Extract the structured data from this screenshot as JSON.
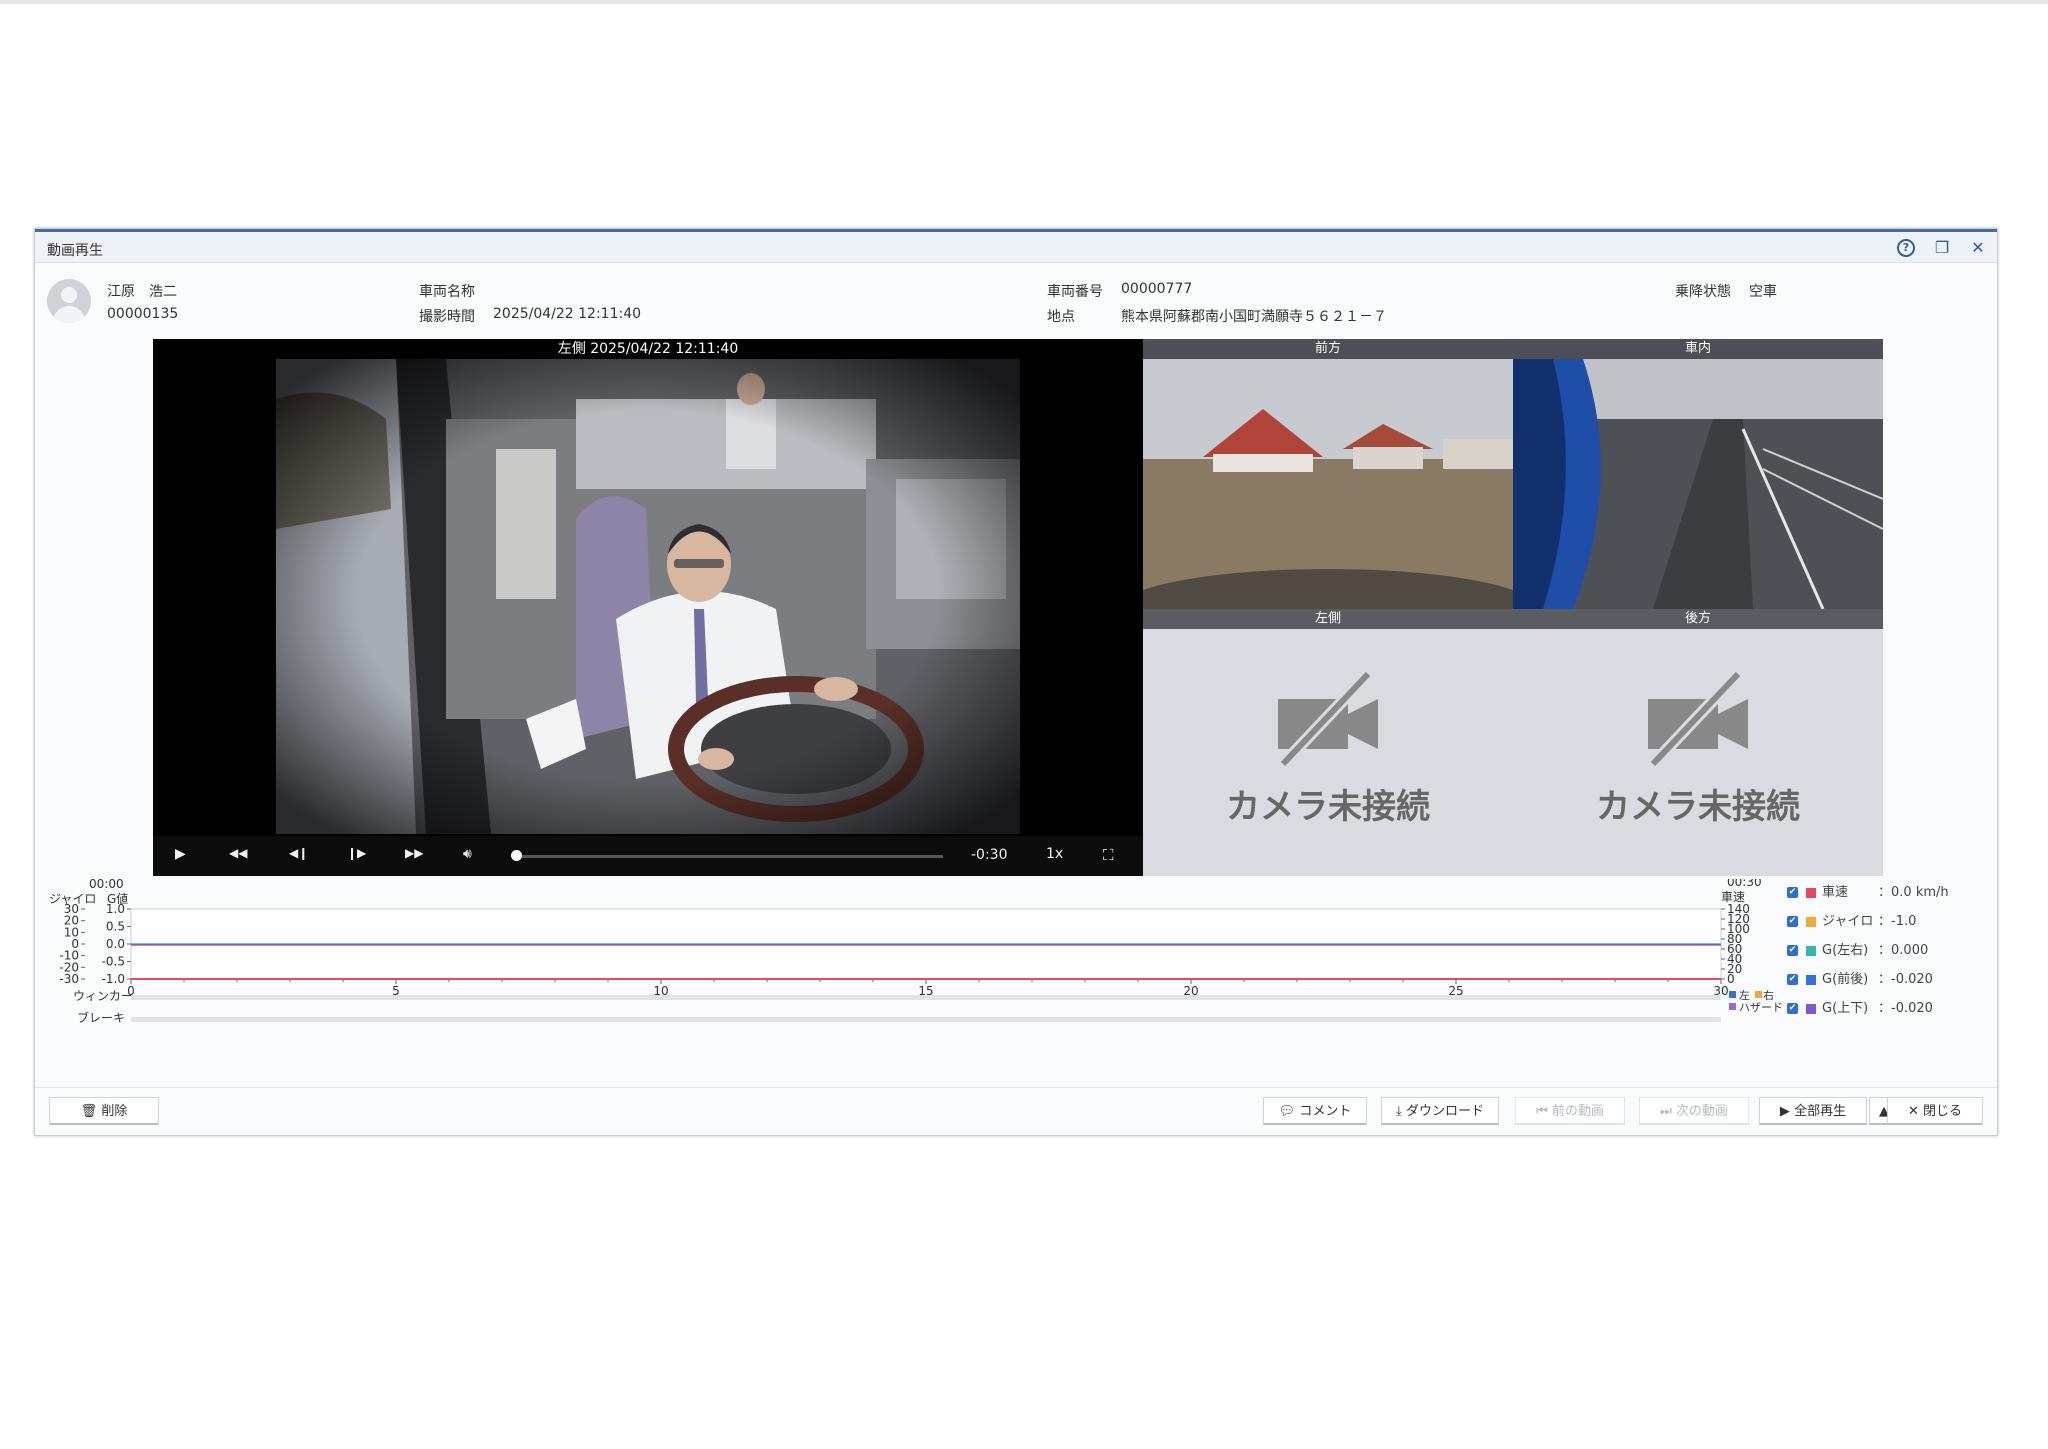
{
  "window": {
    "title": "動画再生",
    "help_icon": "?",
    "restore_icon": "❐",
    "close_icon": "✕"
  },
  "driver": {
    "name": "江原　浩二",
    "id": "00000135"
  },
  "vehicle": {
    "name_label": "車両名称",
    "name_value": "",
    "shot_time_label": "撮影時間",
    "shot_time_value": "2025/04/22 12:11:40",
    "number_label": "車両番号",
    "number_value": "00000777",
    "location_label": "地点",
    "location_value": "熊本県阿蘇郡南小国町満願寺５６２１－７",
    "ride_status_label": "乗降状態",
    "ride_status_value": "空車"
  },
  "main_video": {
    "caption": "左側 2025/04/22 12:11:40",
    "time_remaining": "-0:30",
    "speed": "1x",
    "progress": 0.0
  },
  "cameras": [
    {
      "label": "前方",
      "connected": true
    },
    {
      "label": "車内",
      "connected": true
    },
    {
      "label": "左側",
      "connected": false,
      "message": "カメラ未接続"
    },
    {
      "label": "後方",
      "connected": false,
      "message": "カメラ未接続"
    }
  ],
  "chart_data": {
    "type": "line",
    "start_label": "00:00",
    "end_label": "00:30",
    "x_ticks": [
      0,
      5,
      10,
      15,
      20,
      25,
      30
    ],
    "xlim": [
      0,
      30
    ],
    "left_axis_gyro": {
      "label": "ジャイロ",
      "ticks": [
        30,
        20,
        10,
        0,
        -10,
        -20,
        -30
      ],
      "ylim": [
        -30,
        30
      ]
    },
    "left_axis_g": {
      "label": "G値",
      "ticks": [
        "1.0",
        "0.5",
        "0.0",
        "-0.5",
        "-1.0"
      ],
      "ylim": [
        -1.0,
        1.0
      ]
    },
    "right_axis_speed": {
      "label": "車速",
      "ticks": [
        140,
        120,
        100,
        80,
        60,
        40,
        20,
        0
      ],
      "ylim": [
        0,
        140
      ]
    },
    "series": [
      {
        "name": "車速",
        "color": "#e8495e",
        "value_text": "0.0 km/h",
        "values": [
          0,
          0,
          0,
          0,
          0,
          0,
          0
        ]
      },
      {
        "name": "ジャイロ",
        "color": "#f2a93b",
        "value_text": "-1.0",
        "values": [
          -1,
          -1,
          -1,
          -1,
          -1,
          -1,
          -1
        ]
      },
      {
        "name": "G(左右)",
        "color": "#3bb3a5",
        "value_text": "0.000",
        "values": [
          0,
          0,
          0,
          0,
          0,
          0,
          0
        ]
      },
      {
        "name": "G(前後)",
        "color": "#3b6fd8",
        "value_text": "-0.020",
        "values": [
          -0.02,
          -0.02,
          -0.02,
          -0.02,
          -0.02,
          -0.02,
          -0.02
        ]
      },
      {
        "name": "G(上下)",
        "color": "#7a5bd0",
        "value_text": "-0.020",
        "values": [
          -0.02,
          -0.02,
          -0.02,
          -0.02,
          -0.02,
          -0.02,
          -0.02
        ]
      }
    ],
    "winker_label": "ウィンカー",
    "brake_label": "ブレーキ",
    "winker_legend": {
      "left": "左",
      "right": "右",
      "hazard": "ハザード"
    }
  },
  "footer": {
    "delete": "削除",
    "comment": "コメント",
    "download": "ダウンロード",
    "prev": "前の動画",
    "next": "次の動画",
    "play_all": "全部再生",
    "close": "閉じる"
  }
}
